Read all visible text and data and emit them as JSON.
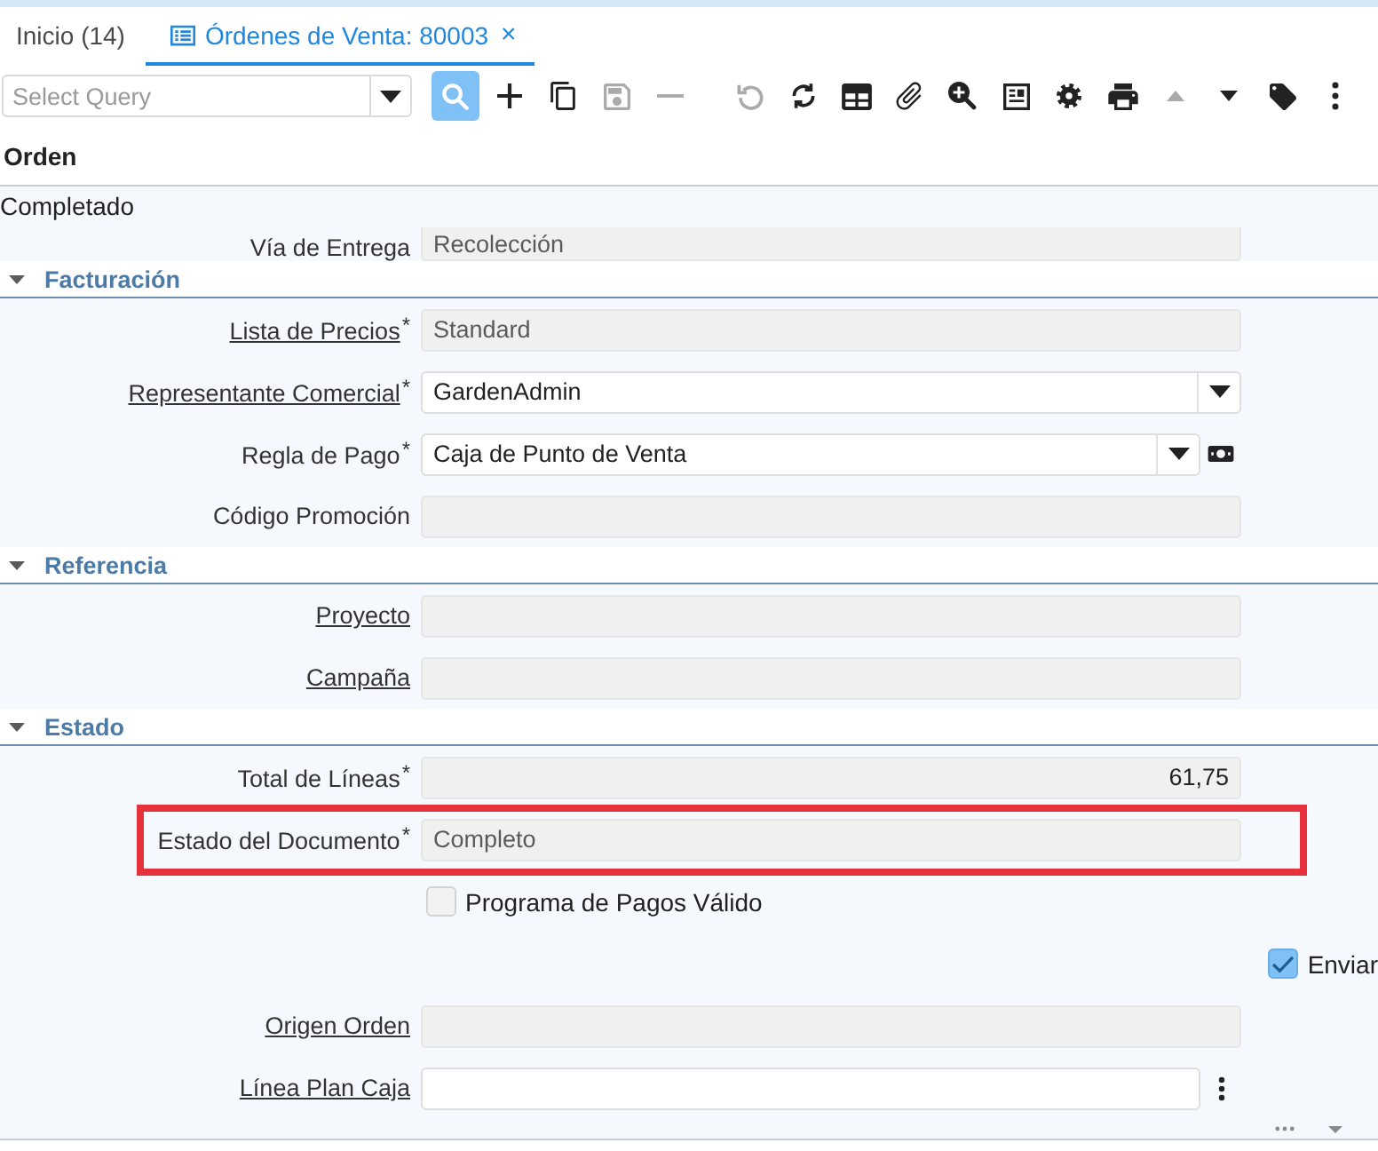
{
  "tabs": [
    {
      "kind": "home",
      "label": "Inicio (14)",
      "selected": false
    },
    {
      "kind": "document",
      "label": "Órdenes de Venta: 80003",
      "selected": true,
      "close": "×"
    }
  ],
  "toolbar": {
    "query": {
      "placeholder": "Select Query"
    },
    "groups": [
      [
        {
          "kind": "search",
          "disabled": false
        },
        {
          "kind": "new",
          "disabled": false
        },
        {
          "kind": "copy",
          "disabled": false
        },
        {
          "kind": "save",
          "disabled": true
        },
        {
          "kind": "delete",
          "disabled": true
        }
      ],
      [
        {
          "kind": "undo",
          "disabled": true
        },
        {
          "kind": "refresh",
          "disabled": false
        },
        {
          "kind": "grid",
          "disabled": false
        },
        {
          "kind": "attach",
          "disabled": false
        },
        {
          "kind": "zoom",
          "disabled": false
        },
        {
          "kind": "report",
          "disabled": false
        },
        {
          "kind": "settings",
          "disabled": false
        },
        {
          "kind": "print",
          "disabled": false
        },
        {
          "kind": "previous",
          "disabled": true
        },
        {
          "kind": "next",
          "disabled": false
        },
        {
          "kind": "tag",
          "disabled": false
        },
        {
          "kind": "more",
          "disabled": false
        }
      ]
    ]
  },
  "panel": {
    "title": "Orden",
    "status": "Completado",
    "partial_row": {
      "label": "Vía de Entrega",
      "value": "Recolección"
    },
    "sections": [
      {
        "title": "Facturación",
        "expanded": true,
        "fields": [
          {
            "kind": "readonly",
            "label": "Lista de Precios$^{*}$",
            "link": true,
            "value": "Standard",
            "highlighted": false
          },
          {
            "kind": "combo",
            "label": "Representante Comercial$^{*}$",
            "link": true,
            "value": "GardenAdmin",
            "highlighted": false
          },
          {
            "kind": "combo",
            "label": "Regla de Pago$^{*}$",
            "link": false,
            "value": "Caja de Punto de Venta",
            "button": {
              "kind": "payment"
            },
            "highlighted": false
          },
          {
            "kind": "readonly",
            "label": "Código Promoción",
            "link": false,
            "highlighted": false
          }
        ]
      },
      {
        "title": "Referencia",
        "expanded": true,
        "fields": [
          {
            "kind": "readonly",
            "label": "Proyecto",
            "link": true,
            "highlighted": false
          },
          {
            "kind": "readonly",
            "label": "Campaña",
            "link": true,
            "highlighted": false
          }
        ]
      },
      {
        "title": "Estado",
        "expanded": true,
        "fields": [
          {
            "kind": "number",
            "label": "Total de Líneas$^{*}$",
            "link": false,
            "value": "61,75",
            "highlighted": false
          },
          {
            "kind": "readonly",
            "label": "Estado del Documento$^{*}$",
            "link": false,
            "value": "Completo",
            "highlighted": true
          },
          {
            "kind": "checkbox",
            "label": "Programa de Pagos Válido",
            "checked": false,
            "highlighted": false
          },
          {
            "kind": "side-checkbox",
            "label": "Enviar",
            "checked": true,
            "highlighted": false
          },
          {
            "kind": "readonly",
            "label": "Origen Orden",
            "link": true,
            "highlighted": false
          },
          {
            "kind": "text",
            "label": "Línea Plan Caja",
            "link": true,
            "button": {
              "kind": "menu"
            },
            "highlighted": false
          }
        ]
      }
    ]
  }
}
